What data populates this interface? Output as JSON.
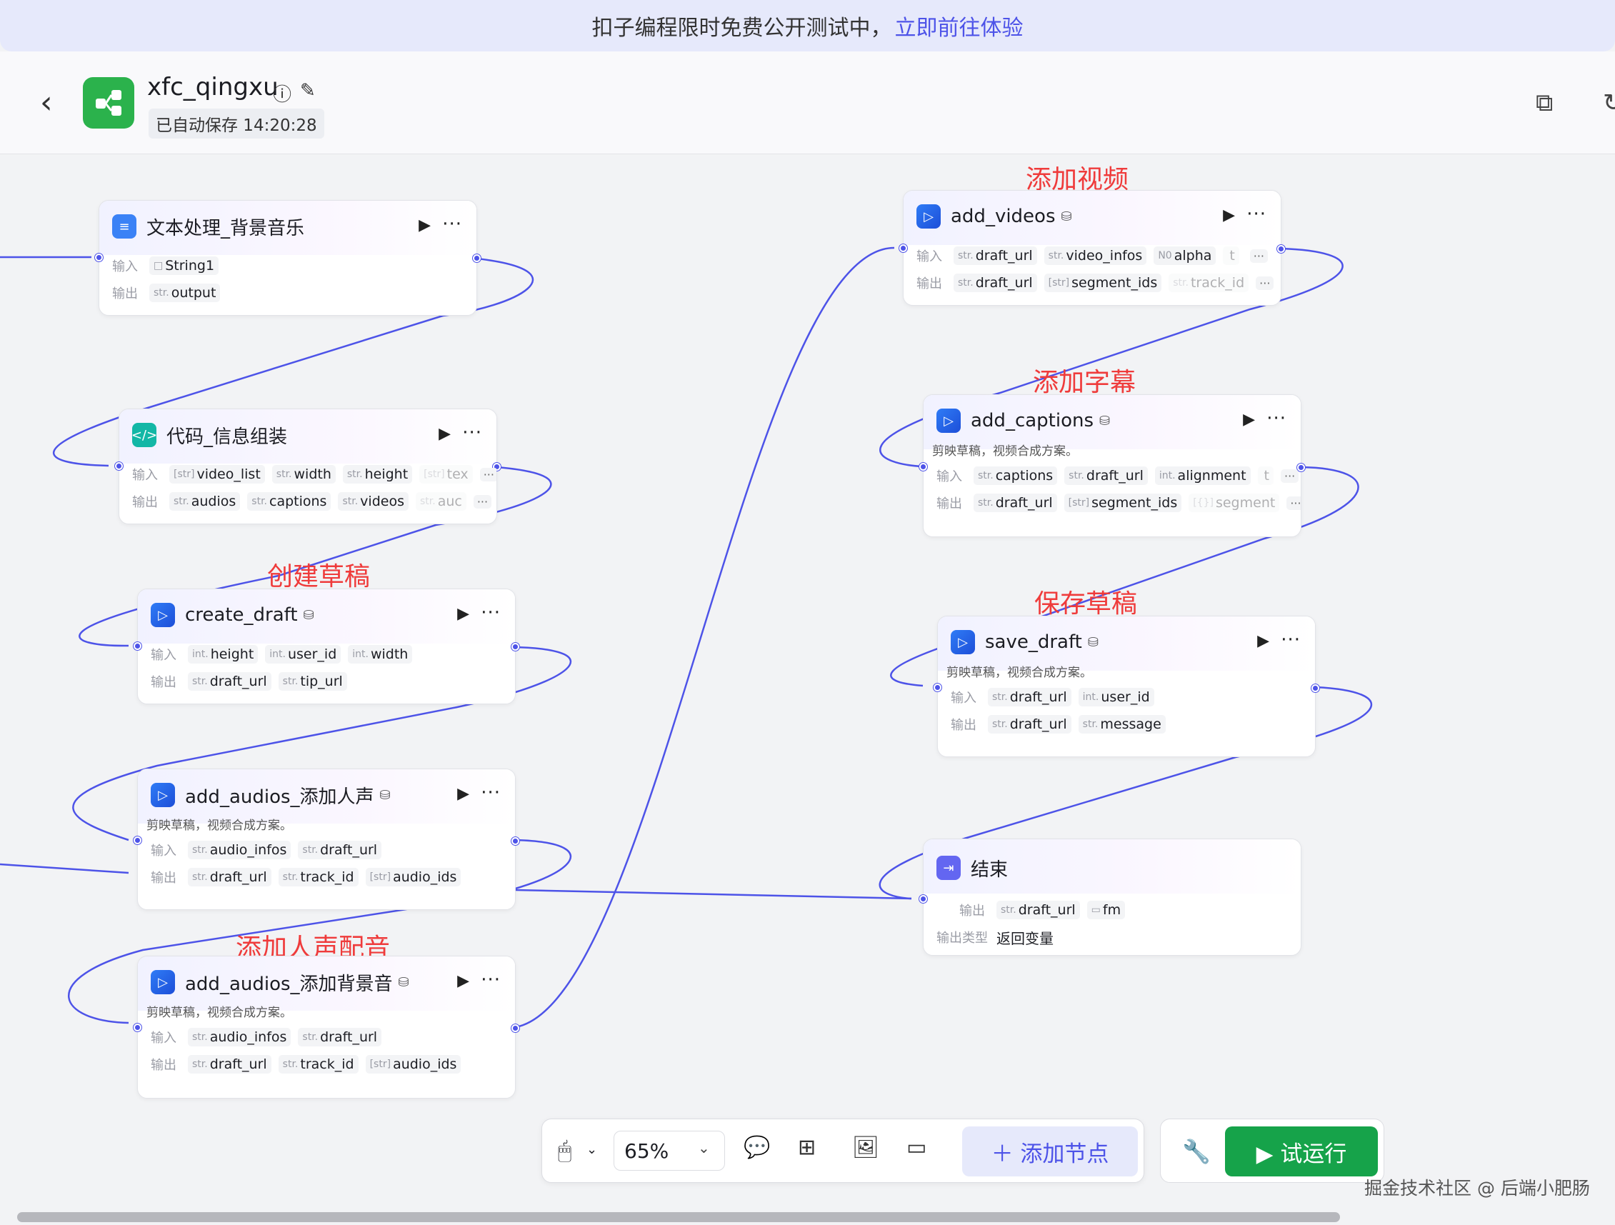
{
  "banner": {
    "text": "扣子编程限时免费公开测试中，",
    "link": "立即前往体验"
  },
  "header": {
    "back": "‹",
    "title": "xfc_qingxu",
    "autosave": "已自动保存 14:20:28"
  },
  "icons": {
    "info": "info-icon",
    "edit": "edit-icon",
    "copy": "copy-icon",
    "sync": "sync-icon"
  },
  "labels": {
    "input": "输入",
    "output": "输出",
    "output_type": "输出类型"
  },
  "annotations": [
    "添加视频",
    "添加字幕",
    "创建草稿",
    "保存草稿",
    "添加人声配音"
  ],
  "nodes": [
    {
      "title": "文本处理_背景音乐",
      "desc": "",
      "inputs": [
        [
          "□",
          "String1"
        ]
      ],
      "outputs": [
        [
          "str.",
          "output"
        ]
      ]
    },
    {
      "title": "代码_信息组装",
      "desc": "",
      "inputs": [
        [
          "[str]",
          "video_list"
        ],
        [
          "str.",
          "width"
        ],
        [
          "str.",
          "height"
        ],
        [
          "[str]",
          "tex"
        ]
      ],
      "outputs": [
        [
          "str.",
          "audios"
        ],
        [
          "str.",
          "captions"
        ],
        [
          "str.",
          "videos"
        ],
        [
          "str.",
          "auc"
        ]
      ]
    },
    {
      "title": "create_draft",
      "desc": "",
      "inputs": [
        [
          "int.",
          "height"
        ],
        [
          "int.",
          "user_id"
        ],
        [
          "int.",
          "width"
        ]
      ],
      "outputs": [
        [
          "str.",
          "draft_url"
        ],
        [
          "str.",
          "tip_url"
        ]
      ]
    },
    {
      "title": "add_audios_添加人声",
      "desc": "剪映草稿，视频合成方案。",
      "inputs": [
        [
          "str.",
          "audio_infos"
        ],
        [
          "str.",
          "draft_url"
        ]
      ],
      "outputs": [
        [
          "str.",
          "draft_url"
        ],
        [
          "str.",
          "track_id"
        ],
        [
          "[str]",
          "audio_ids"
        ]
      ]
    },
    {
      "title": "add_audios_添加背景音",
      "desc": "剪映草稿，视频合成方案。",
      "inputs": [
        [
          "str.",
          "audio_infos"
        ],
        [
          "str.",
          "draft_url"
        ]
      ],
      "outputs": [
        [
          "str.",
          "draft_url"
        ],
        [
          "str.",
          "track_id"
        ],
        [
          "[str]",
          "audio_ids"
        ]
      ]
    },
    {
      "title": "add_videos",
      "desc": "",
      "inputs": [
        [
          "str.",
          "draft_url"
        ],
        [
          "str.",
          "video_infos"
        ],
        [
          "N0",
          "alpha"
        ],
        [
          "",
          "t"
        ]
      ],
      "outputs": [
        [
          "str.",
          "draft_url"
        ],
        [
          "[str]",
          "segment_ids"
        ],
        [
          "str.",
          "track_id"
        ]
      ]
    },
    {
      "title": "add_captions",
      "desc": "剪映草稿，视频合成方案。",
      "inputs": [
        [
          "str.",
          "captions"
        ],
        [
          "str.",
          "draft_url"
        ],
        [
          "int.",
          "alignment"
        ],
        [
          "",
          "t"
        ]
      ],
      "outputs": [
        [
          "str.",
          "draft_url"
        ],
        [
          "[str]",
          "segment_ids"
        ],
        [
          "[{}]",
          "segment"
        ]
      ]
    },
    {
      "title": "save_draft",
      "desc": "剪映草稿，视频合成方案。",
      "inputs": [
        [
          "str.",
          "draft_url"
        ],
        [
          "int.",
          "user_id"
        ]
      ],
      "outputs": [
        [
          "str.",
          "draft_url"
        ],
        [
          "str.",
          "message"
        ]
      ]
    },
    {
      "title": "结束",
      "desc": "",
      "inputs": [],
      "outputs": [
        [
          "str.",
          "draft_url"
        ],
        [
          "▭",
          "fm"
        ]
      ],
      "output_type": "返回变量"
    }
  ],
  "toolbar": {
    "zoom": "65%",
    "add_node": "＋  添加节点",
    "run": "▶  试运行"
  },
  "watermark": "掘金技术社区 @ 后端小肥肠",
  "more": "···",
  "run_glyph": "▶",
  "badge": "⛁"
}
